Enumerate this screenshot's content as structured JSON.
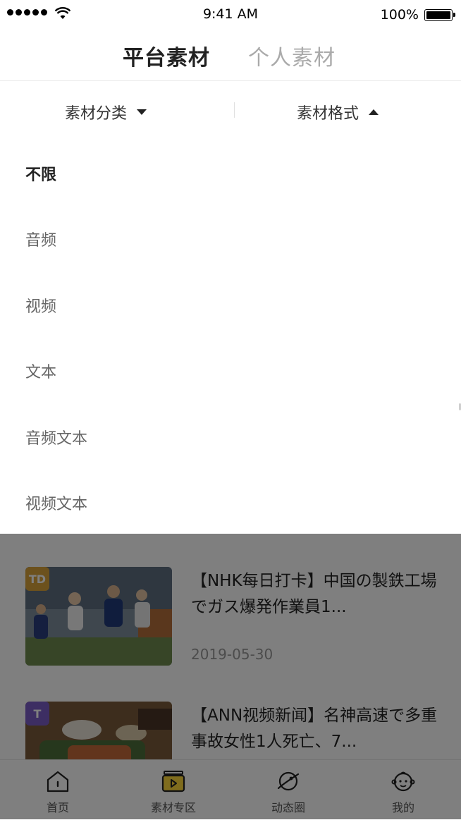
{
  "status_bar": {
    "time": "9:41 AM",
    "battery": "100%"
  },
  "top_tabs": [
    {
      "label": "平台素材",
      "active": true
    },
    {
      "label": "个人素材",
      "active": false
    }
  ],
  "filters": {
    "category_label": "素材分类",
    "format_label": "素材格式"
  },
  "format_options": [
    "不限",
    "音频",
    "视频",
    "文本",
    "音频文本",
    "视频文本"
  ],
  "selected_format": "不限",
  "list": [
    {
      "title": "【NHK每日打卡】中国の製鉄工場でガス爆発作業員1...",
      "date": "2019-05-30",
      "badge": "TD",
      "badge_color": "#d9a33a",
      "thumb": "football-photo"
    },
    {
      "title": "【ANN视频新闻】名神高速で多重事故女性1人死亡、7...",
      "date": "",
      "badge": "T",
      "badge_color": "#7b5cc7",
      "thumb": "food-photo"
    }
  ],
  "bottom_nav": [
    {
      "label": "首页",
      "icon": "home-icon"
    },
    {
      "label": "素材专区",
      "icon": "material-icon"
    },
    {
      "label": "动态圈",
      "icon": "planet-icon"
    },
    {
      "label": "我的",
      "icon": "profile-icon"
    }
  ],
  "colors": {
    "accent": "#ffd83a",
    "overlay": "rgba(0,0,0,0.5)"
  }
}
